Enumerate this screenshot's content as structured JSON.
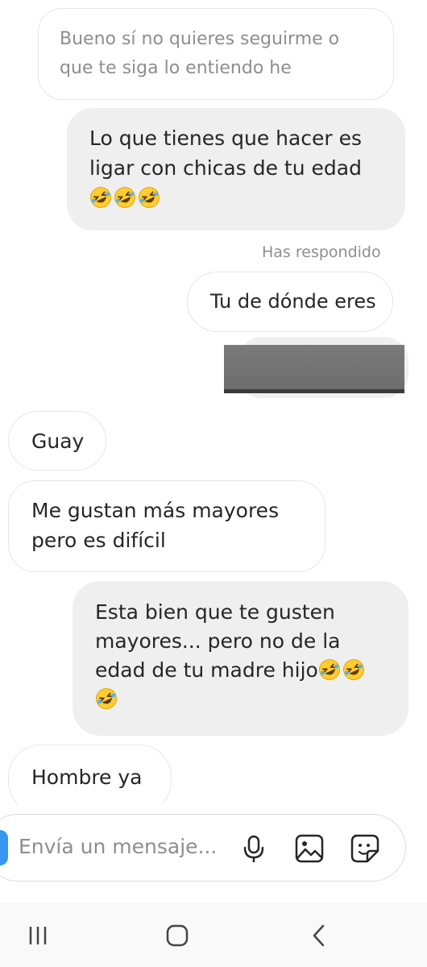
{
  "messages": {
    "quoted_reply": "Bueno sí no quieres seguirme o que te siga lo entiendo he",
    "sent_1_text": "Lo que tienes que hacer es ligar con chicas de tu edad",
    "sent_1_emojis": [
      "rolling-on-floor-laughing-emoji",
      "rolling-on-floor-laughing-emoji",
      "rolling-on-floor-laughing-emoji"
    ],
    "reply_status": "Has respondido",
    "reply_sent_text": "Tu de dónde eres",
    "received_1": "Guay",
    "received_2": "Me gustan más mayores pero es difícil",
    "sent_2_text": "Esta bien que te gusten mayores... pero no de la edad de tu madre hijo",
    "received_3": "Hombre ya"
  },
  "composer": {
    "placeholder": "Envía un mensaje...",
    "icons": [
      "microphone-icon",
      "gallery-icon",
      "sticker-icon"
    ]
  },
  "nav": {
    "icons": [
      "recent-apps-icon",
      "home-icon",
      "back-icon"
    ]
  },
  "colors": {
    "sent_bubble": "#efefef",
    "border": "#e6e6e6",
    "muted_text": "#8e8e8e",
    "accent": "#3797f0",
    "emoji_face": "#ffcc33"
  }
}
